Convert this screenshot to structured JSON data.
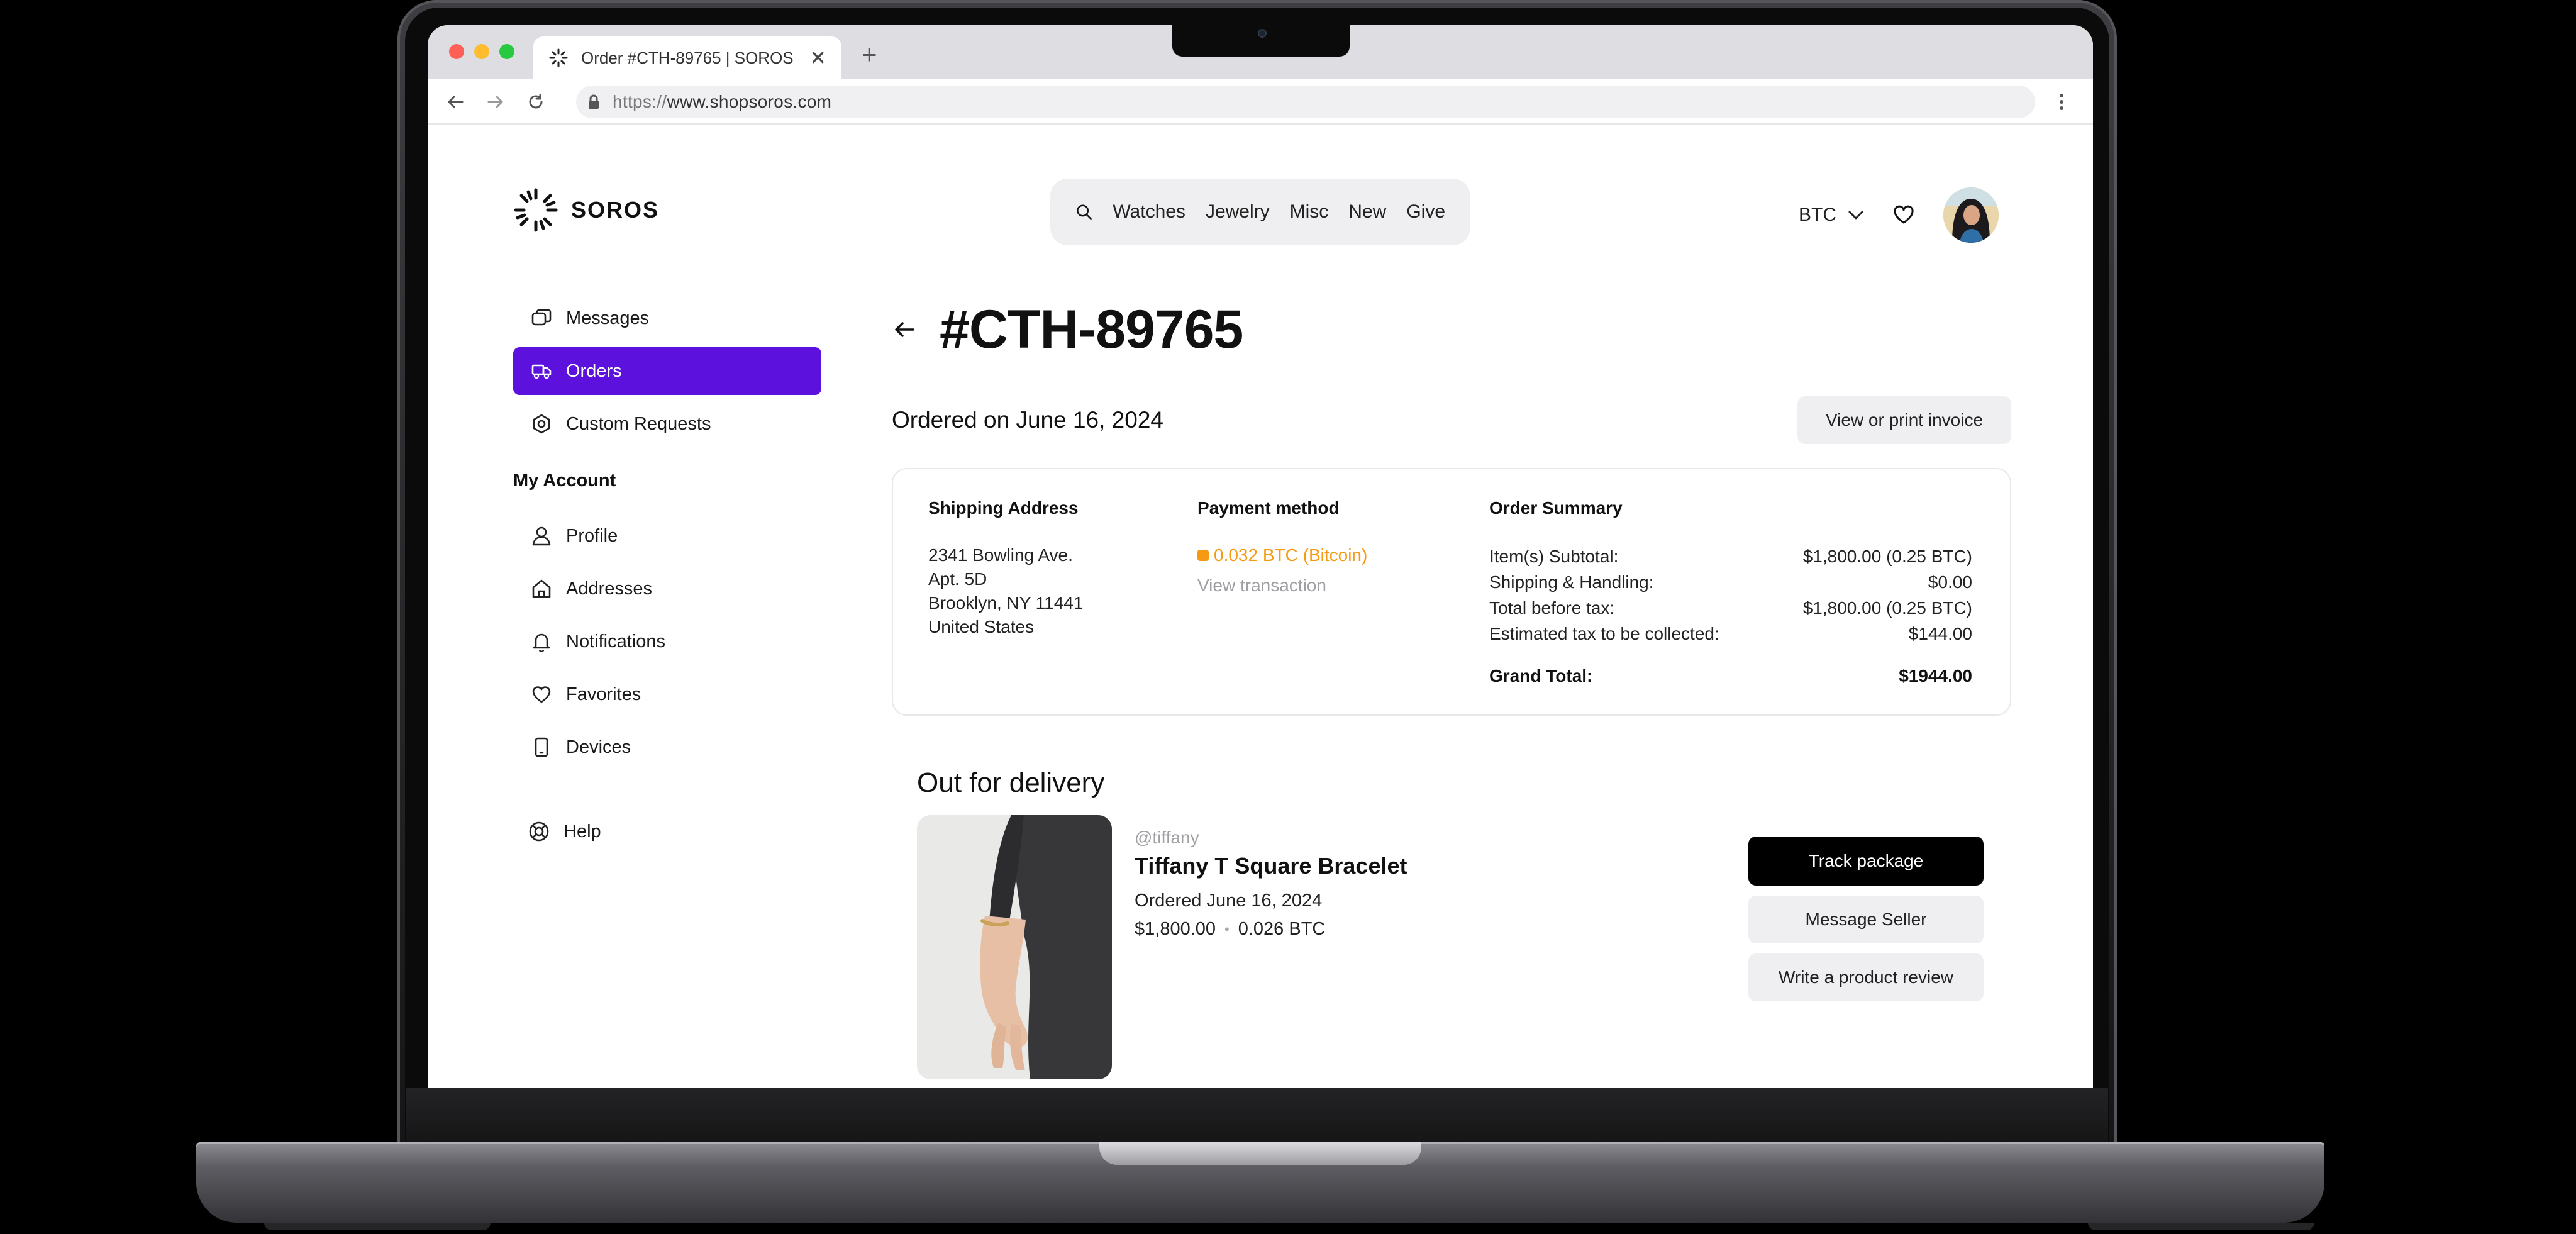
{
  "browser": {
    "tab_title": "Order #CTH-89765 | SOROS",
    "url_scheme": "https://",
    "url_host": "www.shopsoros.com"
  },
  "header": {
    "brand": "SOROS",
    "nav": [
      "Watches",
      "Jewelry",
      "Misc",
      "New",
      "Give"
    ],
    "currency": "BTC"
  },
  "sidebar": {
    "items": [
      {
        "label": "Messages",
        "icon": "messages-icon"
      },
      {
        "label": "Orders",
        "icon": "truck-icon"
      },
      {
        "label": "Custom Requests",
        "icon": "settings-icon"
      }
    ],
    "account_heading": "My Account",
    "account_items": [
      {
        "label": "Profile",
        "icon": "user-icon"
      },
      {
        "label": "Addresses",
        "icon": "home-icon"
      },
      {
        "label": "Notifications",
        "icon": "bell-icon"
      },
      {
        "label": "Favorites",
        "icon": "heart-icon"
      },
      {
        "label": "Devices",
        "icon": "device-icon"
      }
    ],
    "help": {
      "label": "Help",
      "icon": "lifebuoy-icon"
    }
  },
  "order": {
    "number": "#CTH-89765",
    "ordered_on": "Ordered on June 16, 2024",
    "invoice_button": "View or print invoice",
    "shipping": {
      "heading": "Shipping Address",
      "lines": [
        "2341 Bowling Ave.",
        "Apt. 5D",
        "Brooklyn, NY 11441",
        "United States"
      ]
    },
    "payment": {
      "heading": "Payment method",
      "amount": "0.032 BTC (Bitcoin)",
      "link": "View transaction"
    },
    "summary": {
      "heading": "Order Summary",
      "rows": [
        {
          "label": "Item(s) Subtotal:",
          "value": "$1,800.00 (0.25 BTC)"
        },
        {
          "label": "Shipping & Handling:",
          "value": "$0.00"
        },
        {
          "label": "Total before tax:",
          "value": "$1,800.00 (0.25 BTC)"
        },
        {
          "label": "Estimated tax to be collected:",
          "value": "$144.00"
        }
      ],
      "grand_label": "Grand Total:",
      "grand_value": "$1944.00"
    }
  },
  "delivery": {
    "status": "Out for delivery",
    "seller": "@tiffany",
    "product": "Tiffany T Square Bracelet",
    "ordered": "Ordered June 16, 2024",
    "price": "$1,800.00",
    "price_separator": "•",
    "price_btc": "0.026 BTC",
    "buttons": {
      "track": "Track package",
      "message": "Message Seller",
      "review": "Write a product review"
    }
  }
}
